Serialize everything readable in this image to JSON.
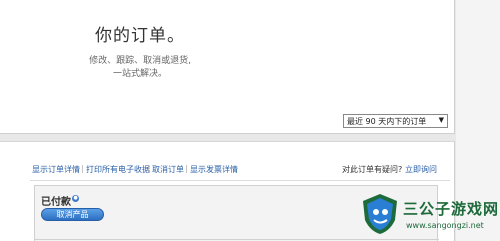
{
  "header": {
    "title": "你的订单。",
    "description_line1": "修改、跟踪、取消或退货,",
    "description_line2": "一站式解决。"
  },
  "filter": {
    "period_selected": "最近 90 天内下的订单",
    "arrow_glyph": "▼"
  },
  "actions": {
    "links": [
      "显示订单详情",
      "打印所有电子收据",
      "取消订单",
      "显示发票详情"
    ],
    "separator": "|",
    "question_text": "对此订单有疑问?",
    "inquiry_link": "立即询问"
  },
  "order": {
    "status": "已付款",
    "info_glyph": "●",
    "cancel_button": "取消产品"
  },
  "watermark": {
    "title": "三公子游戏网",
    "url": "www.sangongzi.net",
    "colors": {
      "green": "#1d6a3a",
      "blue": "#2a7fd4"
    }
  },
  "colors": {
    "link": "#2a5fa8",
    "inquiry": "#c0392b",
    "button": "#2d6fc1"
  }
}
